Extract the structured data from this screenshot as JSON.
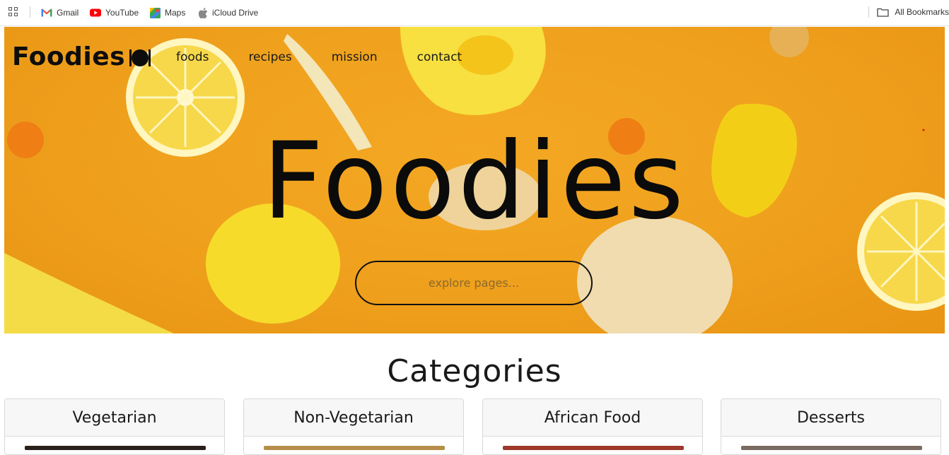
{
  "bookmarks": {
    "items": [
      {
        "label": "Gmail",
        "icon": "gmail-icon"
      },
      {
        "label": "YouTube",
        "icon": "youtube-icon"
      },
      {
        "label": "Maps",
        "icon": "maps-icon"
      },
      {
        "label": "iCloud Drive",
        "icon": "apple-icon"
      }
    ],
    "all_bookmarks": "All Bookmarks"
  },
  "site": {
    "brand": "Foodies",
    "nav": [
      "foods",
      "recipes",
      "mission",
      "contact"
    ],
    "hero_title": "Foodies",
    "search_placeholder": "explore pages..."
  },
  "categories": {
    "title": "Categories",
    "items": [
      "Vegetarian",
      "Non-Vegetarian",
      "African Food",
      "Desserts"
    ]
  },
  "colors": {
    "hero_background": "#f0a21e",
    "text": "#111111",
    "card_header": "#f7f7f7"
  }
}
